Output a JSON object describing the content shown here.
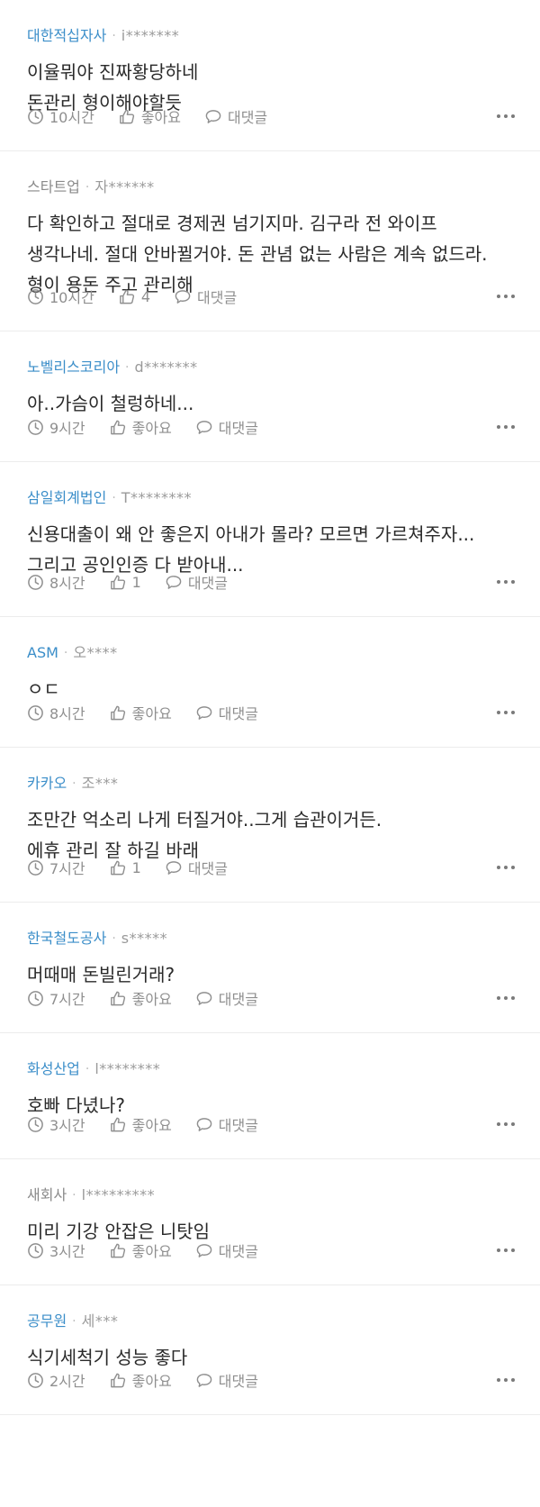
{
  "comments": [
    {
      "company": "대한적십자사",
      "company_verified": true,
      "user": "i*******",
      "text": "이율뭐야 진짜황당하네\n돈관리 형이해야할듯",
      "time": "10시간",
      "likes": "좋아요",
      "reply": "대댓글"
    },
    {
      "company": "스타트업",
      "company_verified": false,
      "user": "자******",
      "text": "다 확인하고 절대로 경제권 넘기지마. 김구라 전 와이프 생각나네. 절대 안바뀔거야. 돈 관념 없는 사람은 계속 없드라. 형이 용돈 주고 관리해",
      "time": "10시간",
      "likes": "4",
      "reply": "대댓글"
    },
    {
      "company": "노벨리스코리아",
      "company_verified": true,
      "user": "d*******",
      "text": "아..가슴이 철렁하네...",
      "time": "9시간",
      "likes": "좋아요",
      "reply": "대댓글"
    },
    {
      "company": "삼일회계법인",
      "company_verified": true,
      "user": "T********",
      "text": "신용대출이 왜 안 좋은지 아내가 몰라? 모르면 가르쳐주자...\n그리고 공인인증 다 받아내...",
      "time": "8시간",
      "likes": "1",
      "reply": "대댓글"
    },
    {
      "company": "ASM",
      "company_verified": true,
      "user": "오****",
      "text": "ㅇㄷ",
      "time": "8시간",
      "likes": "좋아요",
      "reply": "대댓글"
    },
    {
      "company": "카카오",
      "company_verified": true,
      "user": "조***",
      "text": "조만간 억소리 나게 터질거야..그게 습관이거든.\n에휴 관리 잘 하길 바래",
      "time": "7시간",
      "likes": "1",
      "reply": "대댓글"
    },
    {
      "company": "한국철도공사",
      "company_verified": true,
      "user": "s*****",
      "text": "머때매 돈빌린거래?",
      "time": "7시간",
      "likes": "좋아요",
      "reply": "대댓글"
    },
    {
      "company": "화성산업",
      "company_verified": true,
      "user": "l********",
      "text": "호빠 다녔나?",
      "time": "3시간",
      "likes": "좋아요",
      "reply": "대댓글"
    },
    {
      "company": "새회사",
      "company_verified": false,
      "user": "l*********",
      "text": "미리 기강 안잡은 니탓임",
      "time": "3시간",
      "likes": "좋아요",
      "reply": "대댓글"
    },
    {
      "company": "공무원",
      "company_verified": true,
      "user": "세***",
      "text": "식기세척기 성능 좋다",
      "time": "2시간",
      "likes": "좋아요",
      "reply": "대댓글"
    }
  ],
  "icons": {
    "time": "clock-icon",
    "like": "thumbs-up-icon",
    "reply": "speech-bubble-icon",
    "more": "more-horizontal-icon"
  },
  "colors": {
    "verified_company": "#3b8ec9",
    "plain_company": "#8a8a8a",
    "meta_text": "#8f8f8f",
    "divider": "#ececec"
  }
}
